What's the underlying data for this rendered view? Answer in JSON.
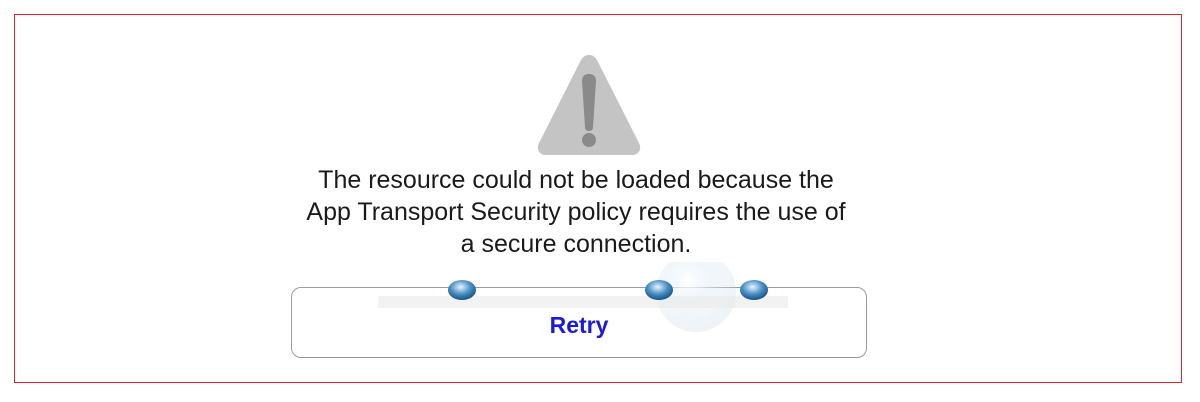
{
  "dialog": {
    "icon": "warning-icon",
    "message_lines": [
      "The resource could not be loaded because the",
      "App Transport Security policy requires the use of",
      "a secure connection."
    ],
    "retry_label": "Retry"
  },
  "colors": {
    "frame_border": "#e0262a",
    "icon_fill": "#c4c4c4",
    "icon_mark": "#8a8a8a",
    "message_text": "#1a1a1a",
    "retry_text": "#1b1bd6",
    "button_border": "#9a9a9a"
  }
}
